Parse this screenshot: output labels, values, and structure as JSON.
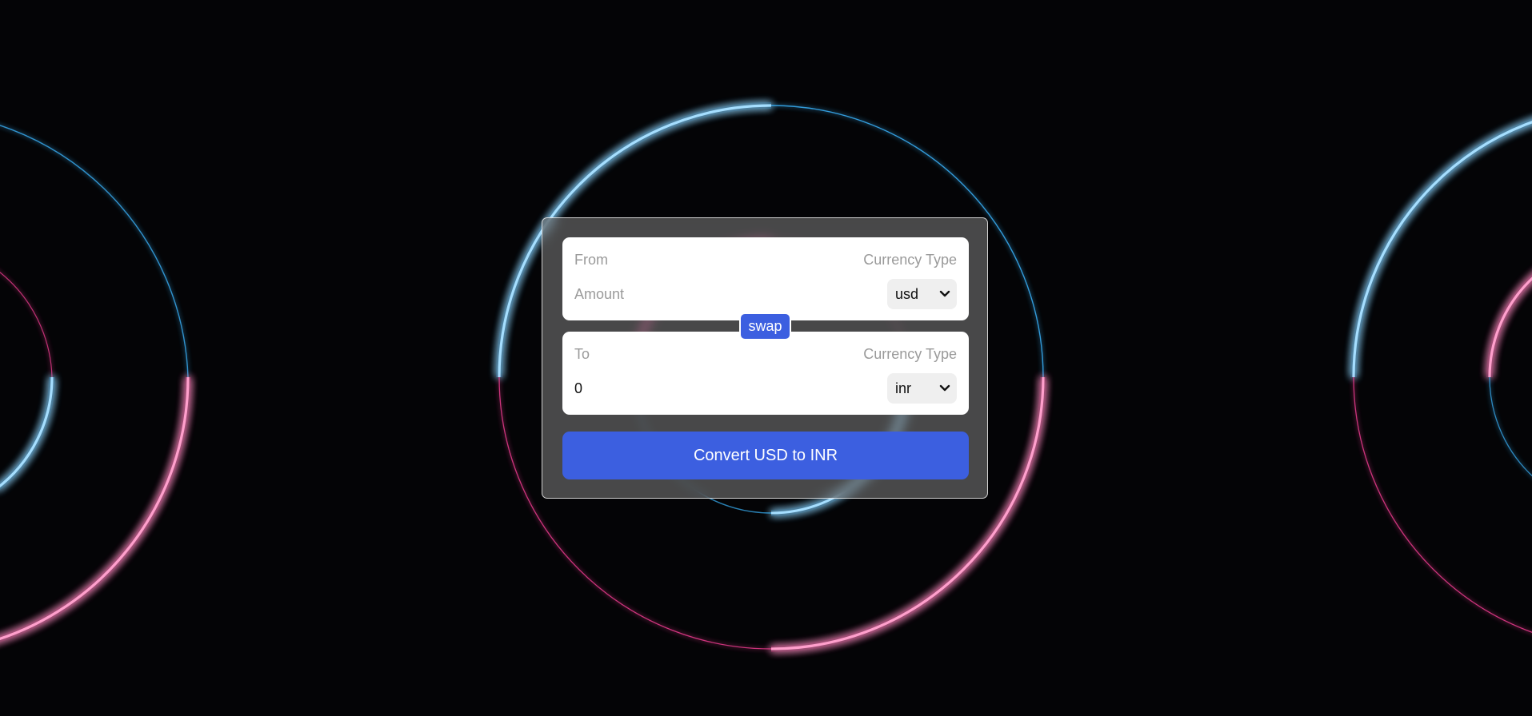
{
  "from": {
    "label": "From",
    "currency_label": "Currency Type",
    "amount_placeholder": "Amount",
    "amount_value": "",
    "currency": "usd"
  },
  "swap_label": "swap",
  "to": {
    "label": "To",
    "currency_label": "Currency Type",
    "amount_value": "0",
    "currency": "inr"
  },
  "convert_label": "Convert USD to INR",
  "colors": {
    "accent": "#3c5fe0",
    "ring_blue": "#3bb6ff",
    "ring_pink": "#ff3f9a",
    "background": "#040406"
  },
  "icons": {
    "select_arrow": "chevron-down-icon"
  }
}
